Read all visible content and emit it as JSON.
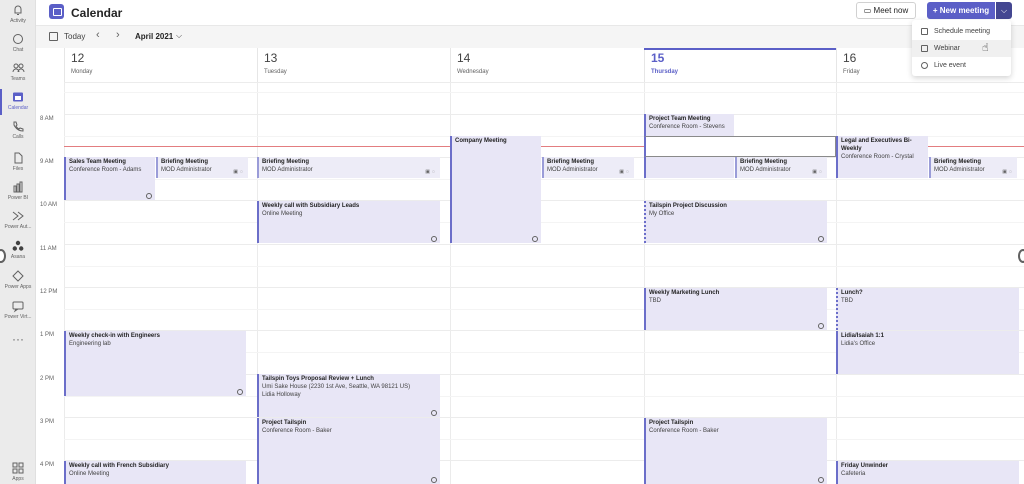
{
  "rail": {
    "items": [
      {
        "label": "Activity",
        "icon": "bell-icon"
      },
      {
        "label": "Chat",
        "icon": "chat-icon"
      },
      {
        "label": "Teams",
        "icon": "teams-icon"
      },
      {
        "label": "Calendar",
        "icon": "calendar-icon"
      },
      {
        "label": "Calls",
        "icon": "phone-icon"
      },
      {
        "label": "Files",
        "icon": "file-icon"
      },
      {
        "label": "Power BI",
        "icon": "power-bi-icon"
      },
      {
        "label": "Power Aut...",
        "icon": "power-automate-icon"
      },
      {
        "label": "Asana",
        "icon": "asana-icon"
      },
      {
        "label": "Power Apps",
        "icon": "power-apps-icon"
      },
      {
        "label": "Power Virt...",
        "icon": "power-virtual-agents-icon"
      }
    ],
    "more": "···",
    "apps_label": "Apps"
  },
  "header": {
    "title": "Calendar",
    "meet_now": "Meet now",
    "new_meeting": "+ New meeting"
  },
  "toolbar": {
    "today": "Today",
    "month": "April 2021"
  },
  "dropdown": {
    "items": [
      "Schedule meeting",
      "Webinar",
      "Live event"
    ]
  },
  "days": [
    {
      "num": "12",
      "name": "Monday"
    },
    {
      "num": "13",
      "name": "Tuesday"
    },
    {
      "num": "14",
      "name": "Wednesday"
    },
    {
      "num": "15",
      "name": "Thursday"
    },
    {
      "num": "16",
      "name": "Friday"
    }
  ],
  "hours": [
    "8 AM",
    "9 AM",
    "10 AM",
    "11 AM",
    "12 PM",
    "1 PM",
    "2 PM",
    "3 PM",
    "4 PM"
  ],
  "events": [
    {
      "title": "Sales Team Meeting",
      "loc": "Conference Room - Adams"
    },
    {
      "title": "Briefing Meeting",
      "loc": "MOD Administrator"
    },
    {
      "title": "Weekly check-in with Engineers",
      "loc": "Engineering lab"
    },
    {
      "title": "Weekly call with French Subsidiary",
      "loc": "Online Meeting"
    },
    {
      "title": "Briefing Meeting",
      "loc": "MOD Administrator"
    },
    {
      "title": "Weekly call with Subsidiary Leads",
      "loc": "Online Meeting"
    },
    {
      "title": "Tailspin Toys Proposal Review + Lunch",
      "loc": "Umi Sake House (2230 1st Ave, Seattle, WA 98121 US)",
      "org": "Lidia Holloway"
    },
    {
      "title": "Project Tailspin",
      "loc": "Conference Room - Baker"
    },
    {
      "title": "Company Meeting",
      "loc": ""
    },
    {
      "title": "Briefing Meeting",
      "loc": "MOD Administrator"
    },
    {
      "title": "Project Team Meeting",
      "loc": "Conference Room - Stevens"
    },
    {
      "title": "Briefing Meeting",
      "loc": "MOD Administrator"
    },
    {
      "title": "Tailspin Project Discussion",
      "loc": "My Office"
    },
    {
      "title": "Weekly Marketing Lunch",
      "loc": "TBD"
    },
    {
      "title": "Project Tailspin",
      "loc": "Conference Room - Baker"
    },
    {
      "title": "Legal and Executives Bi-Weekly",
      "loc": "Conference Room - Crystal"
    },
    {
      "title": "Briefing Meeting",
      "loc": "MOD Administrator"
    },
    {
      "title": "Lunch?",
      "loc": "TBD"
    },
    {
      "title": "Lidia/Isaiah 1:1",
      "loc": "Lidia's Office"
    },
    {
      "title": "Friday Unwinder",
      "loc": "Cafeteria"
    }
  ],
  "colors": {
    "accent": "#5b5fc7",
    "event_bg": "#e8e6f6",
    "now_line": "#e37d80"
  }
}
